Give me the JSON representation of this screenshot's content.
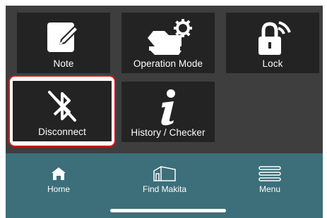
{
  "tiles": {
    "note": "Note",
    "operation_mode": "Operation Mode",
    "lock": "Lock",
    "disconnect": "Disconnect",
    "history_checker": "History / Checker"
  },
  "tabbar": {
    "home": "Home",
    "find": "Find Makita",
    "menu": "Menu"
  },
  "icons": {
    "note": "note-edit-icon",
    "operation_mode": "tool-gear-icon",
    "lock": "lock-wireless-icon",
    "disconnect": "bluetooth-disabled-icon",
    "history_checker": "info-icon",
    "home": "home-icon",
    "find": "store-icon",
    "menu": "menu-icon"
  },
  "colors": {
    "background": "#3e3e3e",
    "tile": "#232323",
    "tabbar": "#3c6f79",
    "selection": "#d9161c"
  }
}
